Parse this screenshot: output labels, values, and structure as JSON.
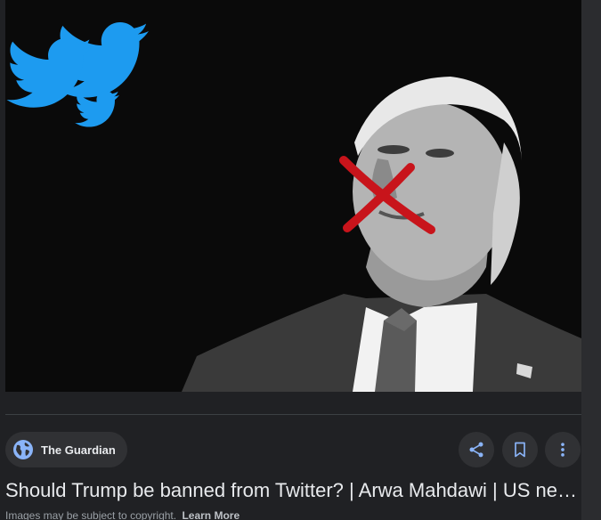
{
  "source": {
    "name": "The Guardian",
    "icon": "globe-icon"
  },
  "actions": {
    "share_icon": "share-icon",
    "save_icon": "bookmark-icon",
    "more_icon": "more-vert-icon"
  },
  "result": {
    "title": "Should Trump be banned from Twitter? | Arwa Mahdawi | US ne…"
  },
  "notice": {
    "text": "Images may be subject to copyright.",
    "link_label": "Learn More"
  },
  "colors": {
    "background": "#202124",
    "chip": "#303134",
    "accent_blue": "#8ab4f8",
    "twitter_blue": "#1d9bf0",
    "mark_red": "#c8141b"
  }
}
